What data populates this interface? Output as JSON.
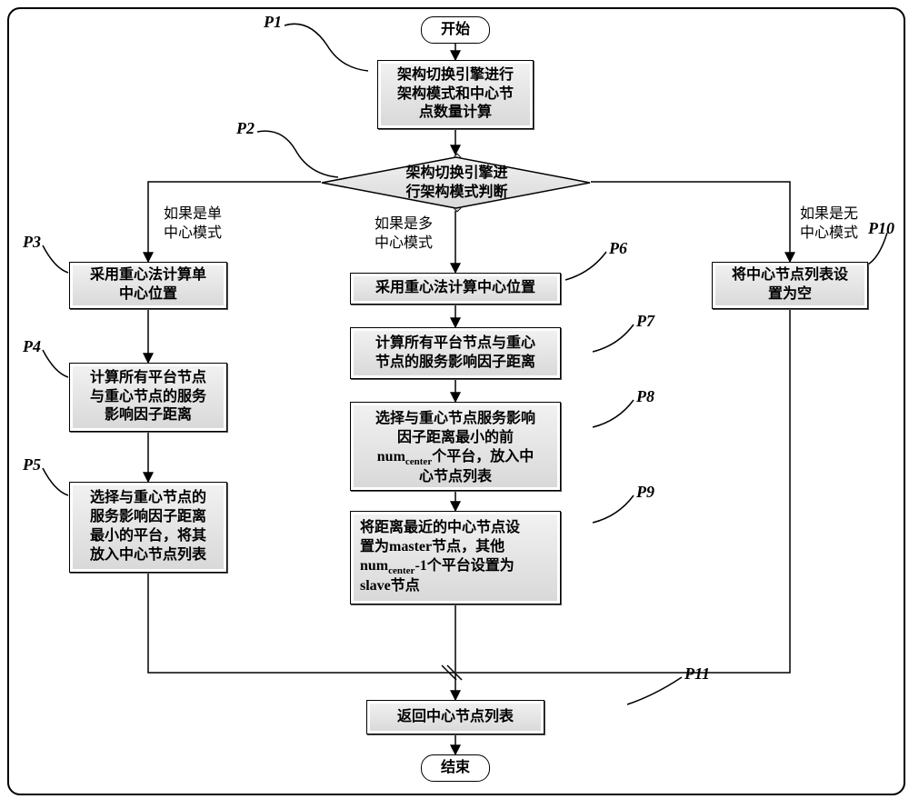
{
  "chart_data": {
    "type": "flowchart",
    "title": "",
    "nodes": [
      {
        "id": "start",
        "type": "terminator",
        "text": "开始"
      },
      {
        "id": "P1",
        "type": "process",
        "text": "架构切换引擎进行架构模式和中心节点数量计算"
      },
      {
        "id": "P2",
        "type": "decision",
        "text": "架构切换引擎进行架构模式判断"
      },
      {
        "id": "P3",
        "type": "process",
        "text": "采用重心法计算单中心位置"
      },
      {
        "id": "P4",
        "type": "process",
        "text": "计算所有平台节点与重心节点的服务影响因子距离"
      },
      {
        "id": "P5",
        "type": "process",
        "text": "选择与重心节点的服务影响因子距离最小的平台，将其放入中心节点列表"
      },
      {
        "id": "P6",
        "type": "process",
        "text": "采用重心法计算中心位置"
      },
      {
        "id": "P7",
        "type": "process",
        "text": "计算所有平台节点与重心节点的服务影响因子距离"
      },
      {
        "id": "P8",
        "type": "process",
        "text": "选择与重心节点服务影响因子距离最小的前num_center个平台，放入中心节点列表"
      },
      {
        "id": "P9",
        "type": "process",
        "text": "将距离最近的中心节点设置为master节点，其他num_center-1个平台设置为slave节点"
      },
      {
        "id": "P10",
        "type": "process",
        "text": "将中心节点列表设置为空"
      },
      {
        "id": "P11",
        "type": "process",
        "text": "返回中心节点列表"
      },
      {
        "id": "end",
        "type": "terminator",
        "text": "结束"
      }
    ],
    "edges": [
      {
        "from": "start",
        "to": "P1"
      },
      {
        "from": "P1",
        "to": "P2"
      },
      {
        "from": "P2",
        "to": "P3",
        "label": "如果是单中心模式"
      },
      {
        "from": "P2",
        "to": "P6",
        "label": "如果是多中心模式"
      },
      {
        "from": "P2",
        "to": "P10",
        "label": "如果是无中心模式"
      },
      {
        "from": "P3",
        "to": "P4"
      },
      {
        "from": "P4",
        "to": "P5"
      },
      {
        "from": "P6",
        "to": "P7"
      },
      {
        "from": "P7",
        "to": "P8"
      },
      {
        "from": "P8",
        "to": "P9"
      },
      {
        "from": "P5",
        "to": "P11"
      },
      {
        "from": "P9",
        "to": "P11"
      },
      {
        "from": "P10",
        "to": "P11"
      },
      {
        "from": "P11",
        "to": "end"
      }
    ]
  },
  "terminators": {
    "start": "开始",
    "end": "结束"
  },
  "labels": {
    "P1": "P1",
    "P2": "P2",
    "P3": "P3",
    "P4": "P4",
    "P5": "P5",
    "P6": "P6",
    "P7": "P7",
    "P8": "P8",
    "P9": "P9",
    "P10": "P10",
    "P11": "P11"
  },
  "p1_text": "架构切换引擎进行\n架构模式和中心节\n点数量计算",
  "p2_text": "架构切换引擎进\n行架构模式判断",
  "branch_single": "如果是单\n中心模式",
  "branch_multi": "如果是多\n中心模式",
  "branch_none": "如果是无\n中心模式",
  "p3_text": "采用重心法计算单\n中心位置",
  "p4_text": "计算所有平台节点\n与重心节点的服务\n影响因子距离",
  "p5_text": "选择与重心节点的\n服务影响因子距离\n最小的平台，将其\n放入中心节点列表",
  "p6_text": "采用重心法计算中心位置",
  "p7_text": "计算所有平台节点与重心\n节点的服务影响因子距离",
  "p8_pre": "选择与重心节点服务影响\n因子距离最小的前\n",
  "p8_num": "num",
  "p8_sub": "center",
  "p8_post": "个平台，放入中\n心节点列表",
  "p9_l1": "将距离最近的中心节点设",
  "p9_l2a": "置为",
  "p9_l2b": "master",
  "p9_l2c": "节点，其他",
  "p9_num": "num",
  "p9_sub": "center",
  "p9_l3b": "-1个平台设置为",
  "p9_l4": "slave节点",
  "p10_text": "将中心节点列表设\n置为空",
  "p11_text": "返回中心节点列表"
}
